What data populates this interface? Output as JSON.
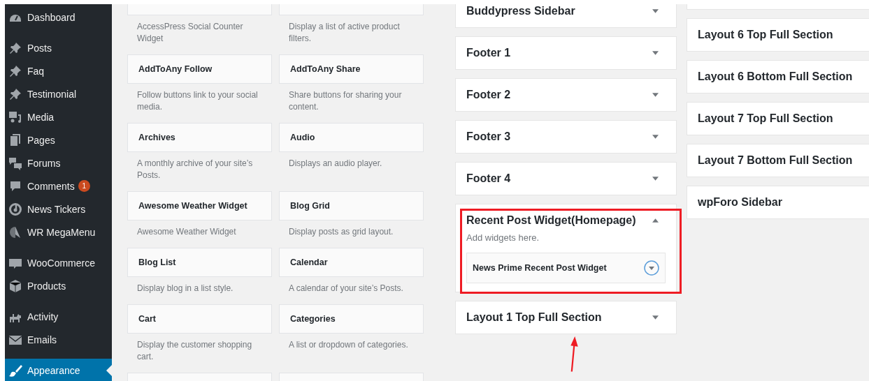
{
  "admin_menu": {
    "groups": [
      {
        "items": [
          {
            "label": "Dashboard",
            "selected": false
          }
        ]
      },
      {
        "items": [
          {
            "label": "Posts",
            "selected": false
          },
          {
            "label": "Faq",
            "selected": false
          },
          {
            "label": "Testimonial",
            "selected": false
          },
          {
            "label": "Media",
            "selected": false
          },
          {
            "label": "Pages",
            "selected": false
          },
          {
            "label": "Forums",
            "selected": false
          },
          {
            "label": "Comments",
            "selected": false,
            "badge": "1"
          },
          {
            "label": "News Tickers",
            "selected": false
          },
          {
            "label": "WR MegaMenu",
            "selected": false
          }
        ]
      },
      {
        "items": [
          {
            "label": "WooCommerce",
            "selected": false
          },
          {
            "label": "Products",
            "selected": false
          }
        ]
      },
      {
        "items": [
          {
            "label": "Activity",
            "selected": false
          },
          {
            "label": "Emails",
            "selected": false
          }
        ]
      },
      {
        "items": [
          {
            "label": "Appearance",
            "selected": true
          }
        ]
      }
    ]
  },
  "available_widgets": [
    {
      "description": "AccessPress Social Counter Widget"
    },
    {
      "description": "Display a list of active product filters."
    },
    {
      "title": "AddToAny Follow",
      "description": "Follow buttons link to your social media."
    },
    {
      "title": "AddToAny Share",
      "description": "Share buttons for sharing your content."
    },
    {
      "title": "Archives",
      "description": "A monthly archive of your site’s Posts."
    },
    {
      "title": "Audio",
      "description": "Displays an audio player."
    },
    {
      "title": "Awesome Weather Widget",
      "description": "Awesome Weather Widget"
    },
    {
      "title": "Blog Grid",
      "description": "Display posts as grid layout."
    },
    {
      "title": "Blog List",
      "description": "Display blog in a list style."
    },
    {
      "title": "Calendar",
      "description": "A calendar of your site’s Posts."
    },
    {
      "title": "Cart",
      "description": "Display the customer shopping cart."
    },
    {
      "title": "Categories",
      "description": "A list or dropdown of categories."
    }
  ],
  "sidebars": {
    "column_1": [
      {
        "title": "Buddypress Sidebar",
        "expanded": false,
        "highlighted": false
      },
      {
        "title": "Footer 1",
        "expanded": false,
        "highlighted": false
      },
      {
        "title": "Footer 2",
        "expanded": false,
        "highlighted": false
      },
      {
        "title": "Footer 3",
        "expanded": false,
        "highlighted": false
      },
      {
        "title": "Footer 4",
        "expanded": false,
        "highlighted": false
      },
      {
        "title": "Recent Post Widget(Homepage)",
        "expanded": true,
        "highlighted": true,
        "hint": "Add widgets here.",
        "widgets": [
          {
            "title": "News Prime Recent Post Widget"
          }
        ]
      },
      {
        "title": "Layout 1 Top Full Section",
        "expanded": false,
        "highlighted": false
      }
    ],
    "column_2": [
      {
        "title": "Layout 6 Top Full Section"
      },
      {
        "title": "Layout 6 Bottom Full Section"
      },
      {
        "title": "Layout 7 Top Full Section"
      },
      {
        "title": "Layout 7 Bottom Full Section"
      },
      {
        "title": "wpForo Sidebar"
      }
    ]
  }
}
